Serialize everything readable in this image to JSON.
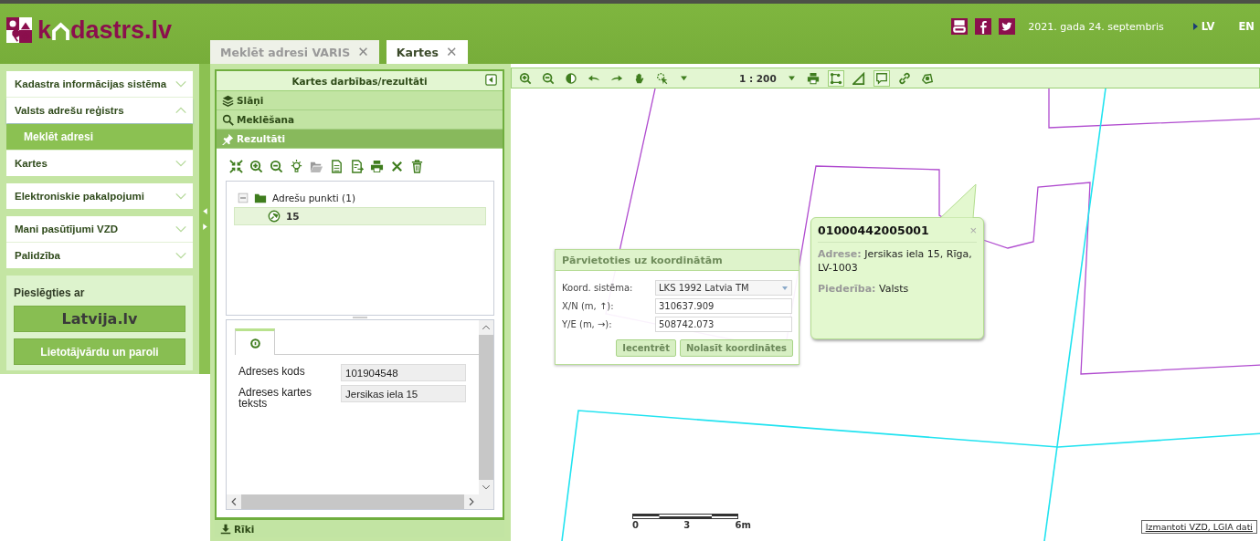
{
  "header": {
    "logo_start": "k",
    "logo_end": "dastrs.lv",
    "date": "2021. gada 24. septembris",
    "languages": [
      {
        "label": "LV",
        "selected": true
      },
      {
        "label": "EN",
        "selected": false
      }
    ]
  },
  "tabs": [
    {
      "label": "Meklēt adresi VARIS",
      "selected": false,
      "close": "✕"
    },
    {
      "label": "Kartes",
      "selected": true,
      "close": "✕"
    }
  ],
  "sidebar": {
    "groups": [
      {
        "items": [
          {
            "label": "Kadastra informācijas sistēma",
            "expanded": false
          },
          {
            "label": "Valsts adrešu reģistrs",
            "expanded": true,
            "children": [
              {
                "label": "Meklēt adresi",
                "selected": true
              }
            ]
          },
          {
            "label": "Kartes",
            "expanded": false
          }
        ]
      },
      {
        "items": [
          {
            "label": "Elektroniskie pakalpojumi",
            "expanded": false
          }
        ]
      },
      {
        "items": [
          {
            "label": "Mani pasūtījumi VZD",
            "expanded": false
          },
          {
            "label": "Palidzība",
            "expanded": false
          }
        ]
      }
    ]
  },
  "login": {
    "title": "Pieslēgties ar",
    "buttons": [
      {
        "label": "Latvija.lv",
        "kind": "logo"
      },
      {
        "label": "Lietotājvārdu un paroli",
        "kind": "text"
      }
    ]
  },
  "panel": {
    "title": "Kartes darbības/rezultāti",
    "sections": [
      {
        "label": "Slāņi",
        "kind": "layers",
        "selected": false
      },
      {
        "label": "Meklēšana",
        "kind": "search",
        "selected": false
      },
      {
        "label": "Rezultāti",
        "kind": "pin",
        "selected": true
      }
    ],
    "tree": {
      "label": "Adrešu punkti (1)",
      "expanded": true,
      "children": [
        {
          "label": "15",
          "selected": true
        }
      ]
    },
    "details": {
      "fields": [
        {
          "label": "Adreses kods",
          "value": "101904548"
        },
        {
          "label": "Adreses kartes teksts",
          "value": "Jersikas iela 15"
        }
      ]
    },
    "footer": {
      "label": "Rīki"
    }
  },
  "map": {
    "scale": "1 : 200",
    "tools": [
      {
        "kind": "zoom-in",
        "selected": false
      },
      {
        "kind": "zoom-out",
        "selected": false
      },
      {
        "kind": "globe",
        "selected": false
      },
      {
        "kind": "back",
        "selected": false
      },
      {
        "kind": "forward",
        "selected": false
      },
      {
        "kind": "hand",
        "selected": false
      },
      {
        "kind": "pointer",
        "selected": false
      },
      {
        "kind": "caret",
        "selected": false
      }
    ],
    "tools_right": [
      {
        "kind": "print",
        "selected": false
      },
      {
        "kind": "vertices",
        "selected": true
      },
      {
        "kind": "angle",
        "selected": false
      },
      {
        "kind": "callout",
        "selected": true
      },
      {
        "kind": "link",
        "selected": false
      },
      {
        "kind": "export",
        "selected": false
      }
    ],
    "coordinate_dialog": {
      "title": "Pārvietoties uz koordinātām",
      "fields": [
        {
          "label": "Koord. sistēma:",
          "value": "LKS 1992 Latvia TM",
          "kind": "select"
        },
        {
          "label": "X/N (m, ↑):",
          "value": "310637.909",
          "kind": "text"
        },
        {
          "label": "Y/E (m, →):",
          "value": "508742.073",
          "kind": "text"
        }
      ],
      "buttons": [
        "Iecentrēt",
        "Nolasīt koordinātes"
      ]
    },
    "info_popup": {
      "title": "01000442005001",
      "close": "×",
      "rows": [
        {
          "label": "Adrese:",
          "value": "Jersikas iela 15, Rīga, LV-1003"
        },
        {
          "label": "Piederība:",
          "value": "Valsts"
        }
      ]
    },
    "scale_bar": {
      "ticks": [
        "0",
        "3",
        "6m"
      ]
    },
    "attribution": "Izmantoti VZD, LGIA dati"
  }
}
